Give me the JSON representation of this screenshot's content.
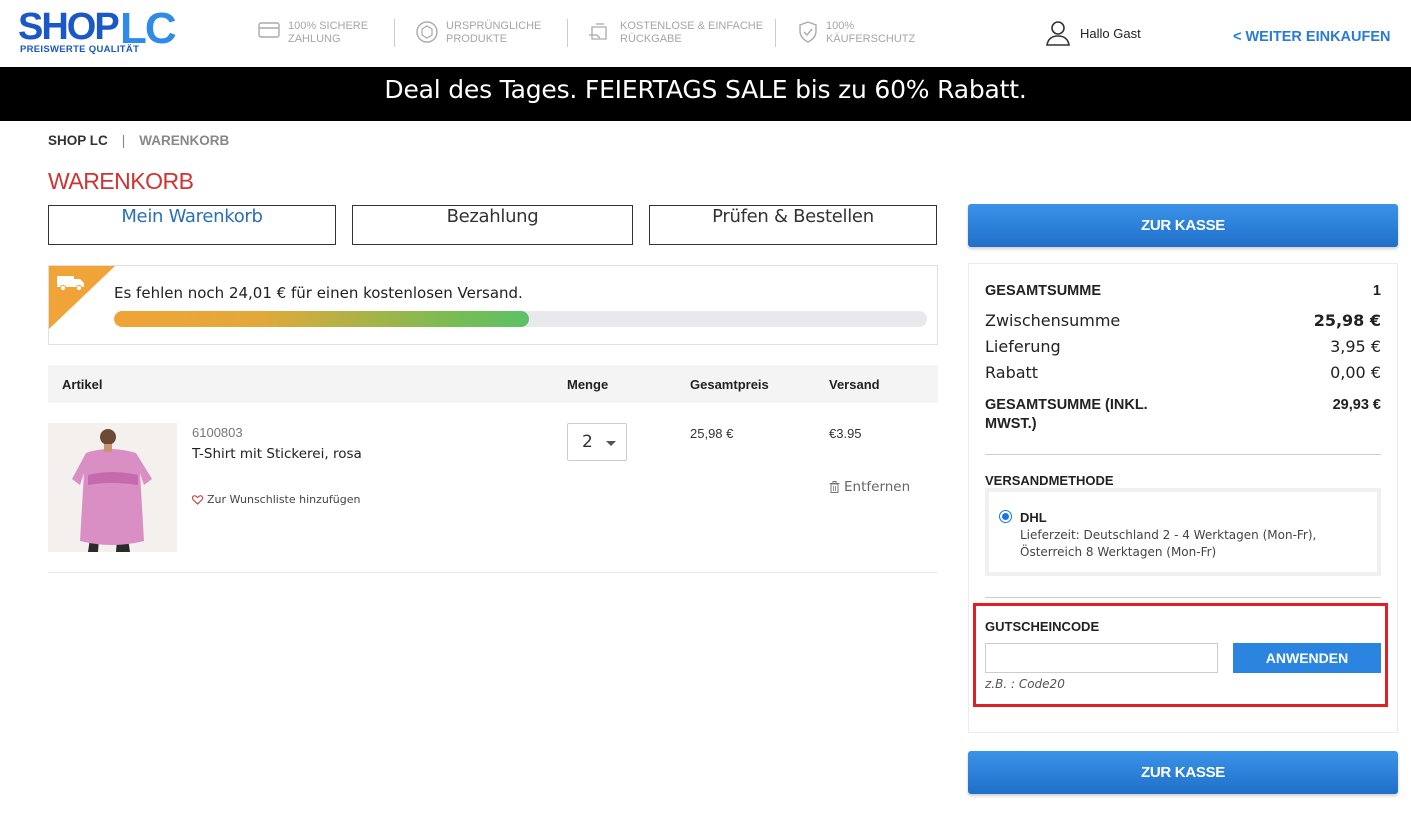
{
  "header": {
    "logo_shop": "SHOP",
    "logo_lc": "LC",
    "logo_tagline": "PREISWERTE QUALITÄT",
    "trust": [
      {
        "icon": "card-icon",
        "line1": "100% SICHERE",
        "line2": "ZAHLUNG"
      },
      {
        "icon": "box-icon",
        "line1": "URSPRÜNGLICHE",
        "line2": "PRODUKTE"
      },
      {
        "icon": "return-icon",
        "line1": "KOSTENLOSE & EINFACHE",
        "line2": "RÜCKGABE"
      },
      {
        "icon": "shield-icon",
        "line1": "100%",
        "line2": "KÄUFERSCHUTZ"
      }
    ],
    "greeting": "Hallo Gast",
    "continue_link": "< WEITER EINKAUFEN"
  },
  "banner": "Deal des Tages. FEIERTAGS SALE bis zu 60% Rabatt.",
  "breadcrumb": {
    "home": "SHOP LC",
    "separator": "|",
    "current": "WARENKORB"
  },
  "page_title": "WARENKORB",
  "steps": [
    "Mein Warenkorb",
    "Bezahlung",
    "Prüfen & Bestellen"
  ],
  "shipping": {
    "message": "Es fehlen noch 24,01 € für einen kostenlosen Versand.",
    "progress_fraction": 0.51
  },
  "table": {
    "headers": {
      "article": "Artikel",
      "qty": "Menge",
      "total": "Gesamtpreis",
      "shipping": "Versand"
    },
    "items": [
      {
        "sku": "6100803",
        "name": "T-Shirt mit Stickerei, rosa",
        "wishlist": "Zur Wunschliste hinzufügen",
        "qty": "2",
        "price": "25,98 €",
        "shipping": "€3.95",
        "remove": "Entfernen"
      }
    ]
  },
  "summary": {
    "checkout_label": "ZUR KASSE",
    "total_label": "GESAMTSUMME",
    "total_count": "1",
    "subtotal_label": "Zwischensumme",
    "subtotal": "25,98 €",
    "delivery_label": "Lieferung",
    "delivery": "3,95 €",
    "discount_label": "Rabatt",
    "discount": "0,00 €",
    "grand_label_1": "GESAMTSUMME (INKL.",
    "grand_label_2": "MWST.)",
    "grand_total": "29,93 €",
    "shipping_method_label": "VERSANDMETHODE",
    "method_name": "DHL",
    "method_desc": "Lieferzeit: Deutschland 2 - 4 Werktagen (Mon-Fr), Österreich 8 Werktagen (Mon-Fr)",
    "coupon_label": "GUTSCHEINCODE",
    "coupon_value": "",
    "coupon_button": "ANWENDEN",
    "coupon_hint": "z.B. : Code20"
  },
  "colors": {
    "accent": "#2a84e0",
    "title_red": "#d03333",
    "highlight": "#e01f26"
  }
}
